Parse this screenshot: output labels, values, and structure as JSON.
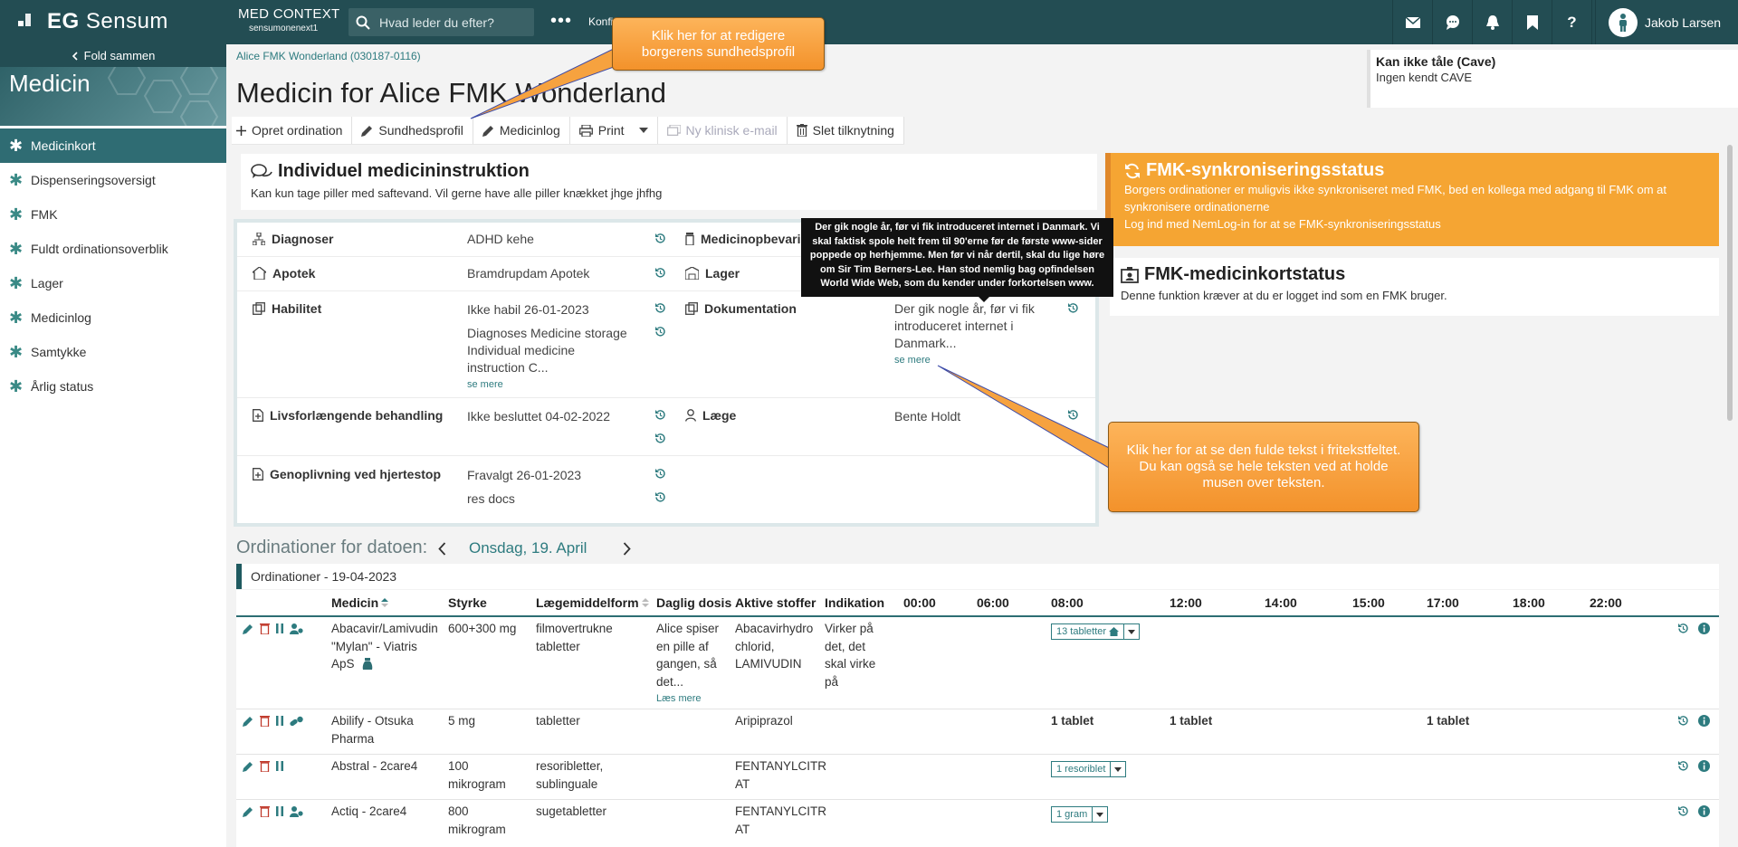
{
  "topbar": {
    "logo_text_bold": "EG",
    "logo_text": "Sensum",
    "context_title": "MED CONTEXT",
    "context_sub": "sensumonenext1",
    "search_placeholder": "Hvad leder du efter?",
    "more_label": "•••",
    "konf_label": "Konfi",
    "icons": [
      "mail-icon",
      "chat-icon",
      "bell-icon",
      "bookmark-icon",
      "help-icon"
    ],
    "help_label": "?",
    "user_name": "Jakob Larsen"
  },
  "sidebar": {
    "fold_label": "Fold sammen",
    "hero_title": "Medicin",
    "items": [
      {
        "label": "Medicinkort",
        "active": true
      },
      {
        "label": "Dispenseringsoversigt"
      },
      {
        "label": "FMK"
      },
      {
        "label": "Fuldt ordinationsoverblik"
      },
      {
        "label": "Lager"
      },
      {
        "label": "Medicinlog"
      },
      {
        "label": "Samtykke"
      },
      {
        "label": "Årlig status"
      }
    ]
  },
  "header": {
    "breadcrumb": "Alice FMK Wonderland (030187-0116)",
    "title": "Medicin for Alice FMK Wonderland",
    "cave_title": "Kan ikke tåle (Cave)",
    "cave_text": "Ingen kendt CAVE"
  },
  "toolbar": {
    "opret": "Opret ordination",
    "sundhedsprofil": "Sundhedsprofil",
    "medicinlog": "Medicinlog",
    "print": "Print",
    "email": "Ny klinisk e-mail",
    "slet": "Slet tilknytning"
  },
  "instruction": {
    "title": "Individuel medicininstruktion",
    "text": "Kan kun tage piller med saftevand. Vil gerne have alle piller knækket jhge jhfhg"
  },
  "info": {
    "diagnoser_label": "Diagnoser",
    "diagnoser_value": "ADHD kehe",
    "medicinopbevaring_label": "Medicinopbevaring",
    "apotek_label": "Apotek",
    "apotek_value": "Bramdrupdam Apotek",
    "lager_label": "Lager",
    "habilitet_label": "Habilitet",
    "habilitet_value": "Ikke habil 26-01-2023",
    "habilitet_value2_l1": "Diagnoses Medicine storage",
    "habilitet_value2_l2": "Individual medicine",
    "habilitet_value2_l3": "instruction C...",
    "habilitet_se_mere": "se mere",
    "dokumentation_label": "Dokumentation",
    "dokumentation_l1": "Der gik nogle år, før vi fik",
    "dokumentation_l2": "introduceret internet i",
    "dokumentation_l3": "Danmark...",
    "dokumentation_se_mere": "se mere",
    "livs_label": "Livsforlængende behandling",
    "livs_value": "Ikke besluttet 04-02-2022",
    "laege_label": "Læge",
    "laege_value": "Bente Holdt",
    "genopl_label": "Genoplivning ved hjertestop",
    "genopl_value": "Fravalgt 26-01-2023",
    "genopl_value2": "res docs"
  },
  "tooltip": {
    "l1": "Der gik nogle år, før vi fik introduceret internet i Danmark. Vi",
    "l2": "skal faktisk spole helt frem til 90'erne før de første www-sider",
    "l3": "poppede op herhjemme. Men før vi når dertil, skal du lige høre",
    "l4": "om Sir Tim Berners-Lee. Han stod nemlig bag opfindelsen",
    "l5": "World Wide Web, som du kender under forkortelsen www."
  },
  "fmk_sync": {
    "title": "FMK-synkroniseringsstatus",
    "l1": "Borgers ordinationer er muligvis ikke synkroniseret med FMK, bed en kollega med adgang til FMK om at",
    "l2": "synkronisere ordinationerne",
    "l3": "Log ind med NemLog-in for at se FMK-synkroniseringsstatus"
  },
  "fmk_card": {
    "title": "FMK-medicinkortstatus",
    "text": "Denne funktion kræver at du er logget ind som en FMK bruger."
  },
  "ordinations": {
    "for_label": "Ordinationer for datoen:",
    "date": "Onsdag, 19. April",
    "header": "Ordinationer - 19-04-2023",
    "columns": [
      "Medicin",
      "Styrke",
      "Lægemiddelform",
      "Daglig dosis",
      "Aktive stoffer",
      "Indikation",
      "00:00",
      "06:00",
      "08:00",
      "12:00",
      "14:00",
      "15:00",
      "17:00",
      "18:00",
      "22:00"
    ],
    "rows": [
      {
        "medicin": [
          "Abacavir/Lamivudin",
          "\"Mylan\" - Viatris",
          "ApS"
        ],
        "styrke": [
          "600+300 mg"
        ],
        "form": [
          "filmovertrukne",
          "tabletter"
        ],
        "dosis": [
          "Alice spiser",
          "en pille af",
          "gangen, så",
          "det..."
        ],
        "laes": "Læs mere",
        "aktive": [
          "Abacavirhydro",
          "chlorid,",
          "LAMIVUDIN"
        ],
        "indikation": [
          "Virker på",
          "det, det",
          "skal virke",
          "på"
        ],
        "dose_box": "13 tabletter"
      },
      {
        "medicin": [
          "Abilify - Otsuka",
          "Pharma"
        ],
        "styrke": [
          "5 mg"
        ],
        "form": [
          "tabletter"
        ],
        "aktive": [
          "Aripiprazol"
        ],
        "t0800": "1 tablet",
        "t1200": "1 tablet",
        "t1700": "1 tablet"
      },
      {
        "medicin": [
          "Abstral - 2care4"
        ],
        "styrke": [
          "100",
          "mikrogram"
        ],
        "form": [
          "resoribletter,",
          "sublinguale"
        ],
        "aktive": [
          "FENTANYLCITR",
          "AT"
        ],
        "dose_box": "1 resoriblet"
      },
      {
        "medicin": [
          "Actiq - 2care4"
        ],
        "styrke": [
          "800",
          "mikrogram"
        ],
        "form": [
          "sugetabletter"
        ],
        "aktive": [
          "FENTANYLCITR",
          "AT"
        ],
        "dose_box": "1 gram"
      }
    ]
  },
  "callouts": {
    "c1_l1": "Klik her for at redigere",
    "c1_l2": "borgerens sundhedsprofil",
    "c2_l1": "Klik her for at se den fulde tekst i fritekstfeltet.",
    "c2_l2": "Du kan også se hele teksten ved at holde",
    "c2_l3": "musen over teksten."
  },
  "colors": {
    "topbar": "#234d53",
    "accent": "#2d7b7f",
    "fmk_orange": "#f5a533",
    "callout_orange": "#f3922b"
  }
}
